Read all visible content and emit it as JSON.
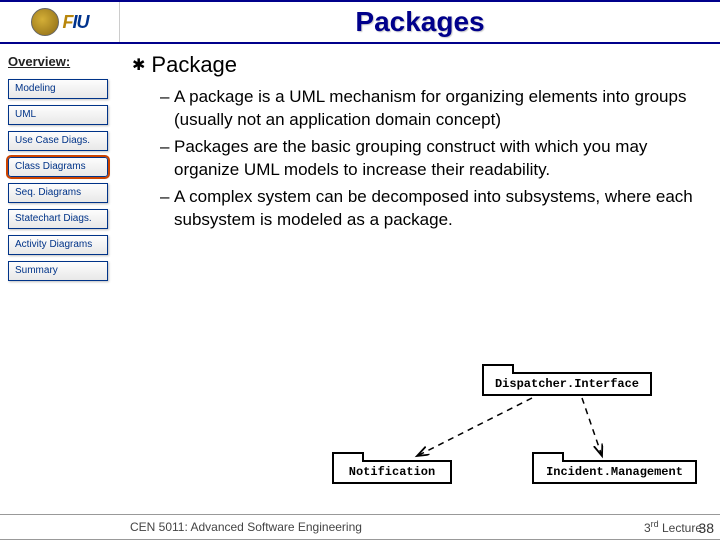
{
  "header": {
    "logo_main": "FIU",
    "title": "Packages"
  },
  "sidebar": {
    "title": "Overview:",
    "items": [
      {
        "label": "Modeling",
        "highlight": false
      },
      {
        "label": "UML",
        "highlight": false
      },
      {
        "label": "Use Case Diags.",
        "highlight": false
      },
      {
        "label": "Class Diagrams",
        "highlight": true
      },
      {
        "label": "Seq. Diagrams",
        "highlight": false
      },
      {
        "label": "Statechart Diags.",
        "highlight": false
      },
      {
        "label": "Activity Diagrams",
        "highlight": false
      },
      {
        "label": "Summary",
        "highlight": false
      }
    ]
  },
  "content": {
    "heading": "Package",
    "bullets": [
      "A package is a UML mechanism for organizing elements into groups  (usually not an application domain concept)",
      "Packages are the basic grouping construct with which you may organize UML models to increase their readability.",
      "A complex system can be decomposed into subsystems, where each subsystem is modeled as a package."
    ]
  },
  "diagram": {
    "dispatcher": "Dispatcher.Interface",
    "notification": "Notification",
    "incident": "Incident.Management"
  },
  "footer": {
    "course": "CEN 5011: Advanced Software Engineering",
    "lecture_num": "3",
    "lecture_suffix": "rd",
    "lecture_word": " Lecture",
    "page": "38"
  }
}
